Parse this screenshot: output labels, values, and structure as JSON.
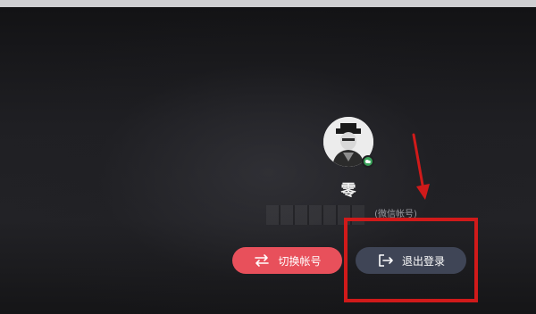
{
  "profile": {
    "username": "零",
    "subtitle": "(微信帐号)"
  },
  "buttons": {
    "switch_account": "切换帐号",
    "logout": "退出登录"
  },
  "icons": {
    "avatar": "avatar-image",
    "badge": "wechat-badge-icon",
    "switch": "swap-arrows-icon",
    "logout": "logout-icon",
    "annotation_arrow": "red-arrow-icon"
  },
  "colors": {
    "switch_button": "#e8505b",
    "logout_button": "#3f4556",
    "highlight": "#d01a1a",
    "badge": "#3aa35b"
  }
}
